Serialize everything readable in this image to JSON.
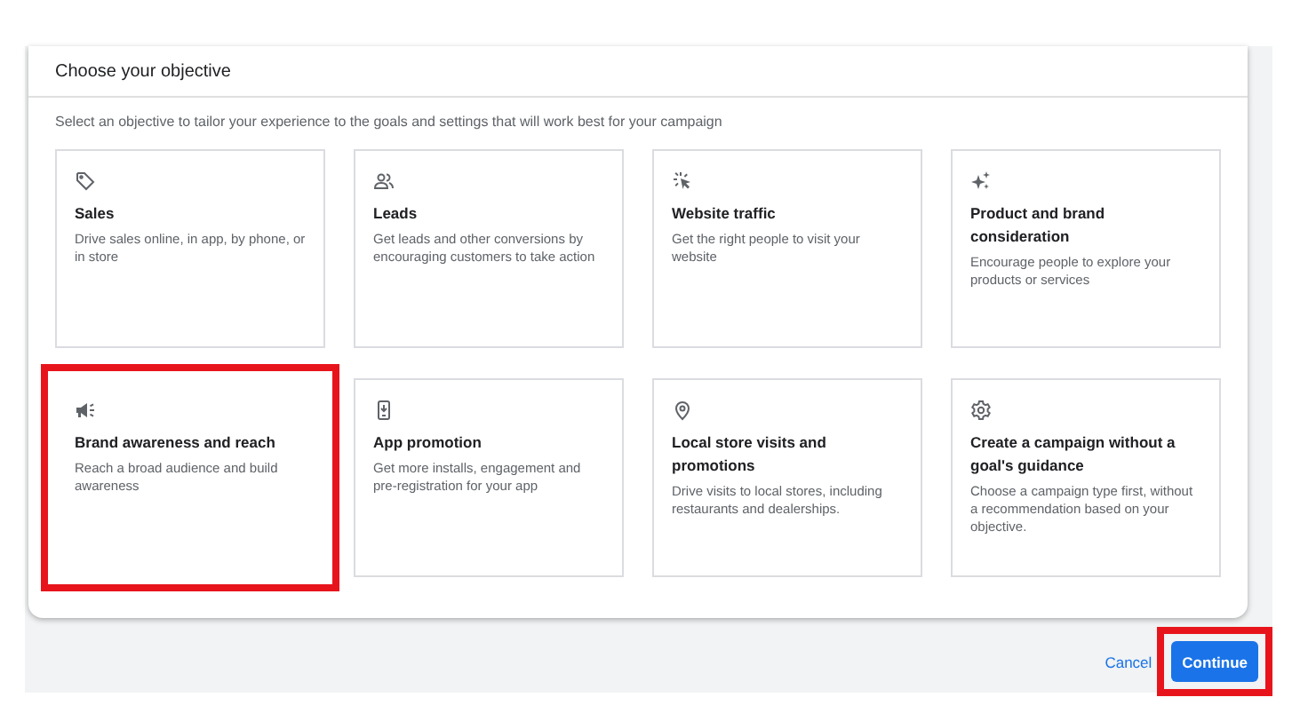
{
  "dialog": {
    "title": "Choose your objective",
    "subtitle": "Select an objective to tailor your experience to the goals and settings that will work best for your campaign",
    "objectives": [
      {
        "title": "Sales",
        "description": "Drive sales online, in app, by phone, or in store",
        "highlighted": false
      },
      {
        "title": "Leads",
        "description": "Get leads and other conversions by encouraging customers to take action",
        "highlighted": false
      },
      {
        "title": "Website traffic",
        "description": "Get the right people to visit your website",
        "highlighted": false
      },
      {
        "title": "Product and brand consideration",
        "description": "Encourage people to explore your products or services",
        "highlighted": false
      },
      {
        "title": "Brand awareness and reach",
        "description": "Reach a broad audience and build awareness",
        "highlighted": true
      },
      {
        "title": "App promotion",
        "description": "Get more installs, engagement and pre-registration for your app",
        "highlighted": false
      },
      {
        "title": "Local store visits and promotions",
        "description": "Drive visits to local stores, including restaurants and dealerships.",
        "highlighted": false
      },
      {
        "title": "Create a campaign without a goal's guidance",
        "description": "Choose a campaign type first, without a recommendation based on your objective.",
        "highlighted": false
      }
    ]
  },
  "footer": {
    "cancel": {
      "label": "Cancel"
    },
    "continue": {
      "label": "Continue",
      "highlighted": true
    }
  }
}
